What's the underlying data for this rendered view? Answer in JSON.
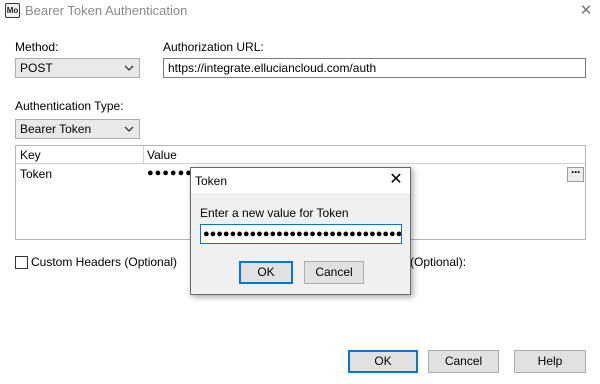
{
  "window": {
    "app_icon_text": "Mo",
    "title": "Bearer Token Authentication",
    "close_glyph": "✕"
  },
  "method": {
    "label": "Method:",
    "value": "POST"
  },
  "auth_url": {
    "label": "Authorization URL:",
    "value": "https://integrate.elluciancloud.com/auth"
  },
  "auth_type": {
    "label": "Authentication Type:",
    "value": "Bearer Token"
  },
  "grid": {
    "columns": [
      "Key",
      "Value"
    ],
    "rows": [
      {
        "key": "Token",
        "value": "●●●●●●●",
        "ellipsis": "···"
      }
    ]
  },
  "custom_headers": {
    "label": "Custom Headers (Optional)",
    "checked": false
  },
  "partial_label": "(Optional):",
  "buttons": {
    "ok": "OK",
    "cancel": "Cancel",
    "help": "Help"
  },
  "modal": {
    "title": "Token",
    "close_glyph": "✕",
    "prompt": "Enter a new value for Token",
    "masked_value": "●●●●●●●●●●●●●●●●●●●●●●●●●●●●●●",
    "ok": "OK",
    "cancel": "Cancel"
  },
  "colors": {
    "accent": "#0078d7",
    "dialog_bg": "#f0f0f0",
    "button_bg": "#e1e1e1",
    "title_gray": "#8a8a8a"
  }
}
